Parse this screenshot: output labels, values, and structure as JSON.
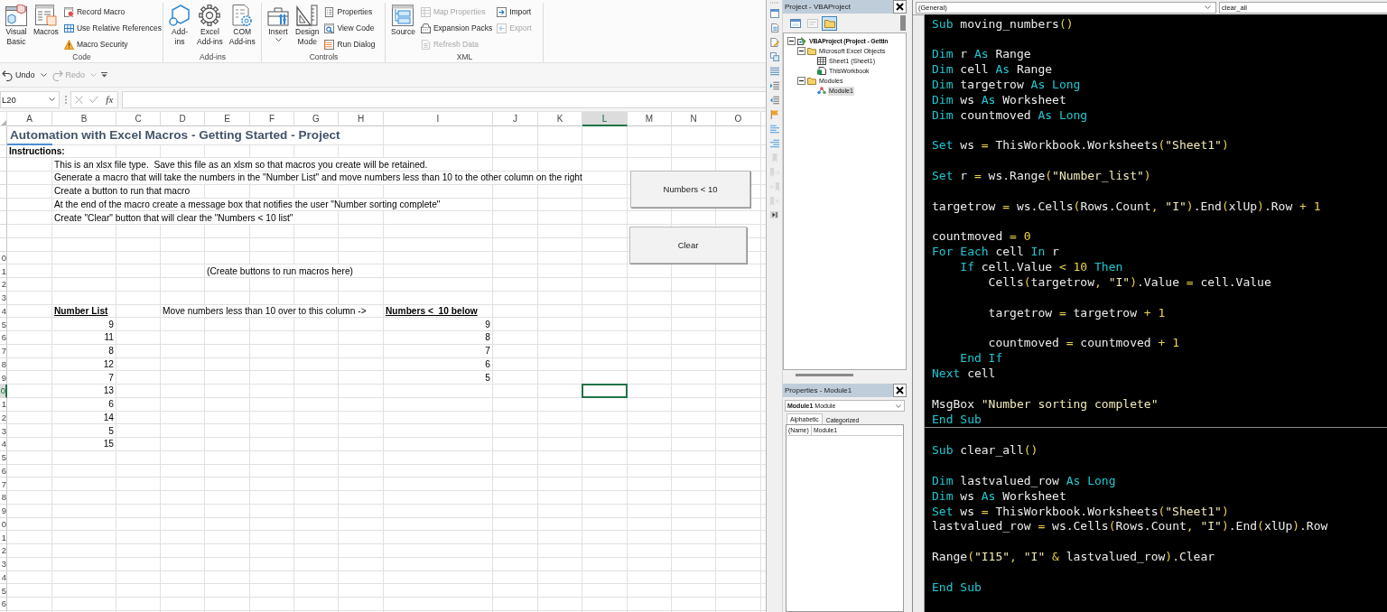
{
  "ribbon": {
    "groups": [
      {
        "label": "Code",
        "items": [
          {
            "label": "Visual\nBasic",
            "kind": "large",
            "disabled": false,
            "menu": false
          },
          {
            "label": "Macros",
            "kind": "large",
            "disabled": false,
            "menu": false
          },
          {
            "label": "Record Macro",
            "kind": "small",
            "disabled": false,
            "menu": false
          },
          {
            "label": "Use Relative References",
            "kind": "small",
            "disabled": false,
            "menu": false
          },
          {
            "label": "Macro Security",
            "kind": "small",
            "disabled": false,
            "menu": false
          }
        ]
      },
      {
        "label": "Add-ins",
        "items": [
          {
            "label": "Add-\nins",
            "kind": "large",
            "disabled": false,
            "menu": false
          },
          {
            "label": "Excel\nAdd-ins",
            "kind": "large",
            "disabled": false,
            "menu": false
          },
          {
            "label": "COM\nAdd-ins",
            "kind": "large",
            "disabled": false,
            "menu": false
          }
        ]
      },
      {
        "label": "Controls",
        "items": [
          {
            "label": "Insert",
            "kind": "large",
            "disabled": false,
            "menu": true
          },
          {
            "label": "Design\nMode",
            "kind": "large",
            "disabled": false,
            "menu": false
          },
          {
            "label": "Properties",
            "kind": "small",
            "disabled": false,
            "menu": false
          },
          {
            "label": "View Code",
            "kind": "small",
            "disabled": false,
            "menu": false
          },
          {
            "label": "Run Dialog",
            "kind": "small",
            "disabled": false,
            "menu": false
          }
        ]
      },
      {
        "label": "XML",
        "items": [
          {
            "label": "Source",
            "kind": "large",
            "disabled": false,
            "menu": false
          },
          {
            "label": "Map Properties",
            "kind": "small",
            "disabled": true,
            "menu": false
          },
          {
            "label": "Expansion Packs",
            "kind": "small",
            "disabled": false,
            "menu": false
          },
          {
            "label": "Refresh Data",
            "kind": "small",
            "disabled": true,
            "menu": false
          },
          {
            "label": "Import",
            "kind": "small",
            "disabled": false,
            "menu": false
          },
          {
            "label": "Export",
            "kind": "small",
            "disabled": true,
            "menu": false
          }
        ]
      }
    ]
  },
  "quick_access": {
    "items": [
      {
        "label": "Undo",
        "disabled": false,
        "menu": true
      },
      {
        "label": "Redo",
        "disabled": true,
        "menu": true
      }
    ]
  },
  "formula_bar": {
    "name_box": "L20",
    "function_label": "fx"
  },
  "sheet": {
    "columns": [
      {
        "label": "A",
        "selected": false
      },
      {
        "label": "B",
        "selected": false
      },
      {
        "label": "C",
        "selected": false
      },
      {
        "label": "D",
        "selected": false
      },
      {
        "label": "E",
        "selected": false
      },
      {
        "label": "F",
        "selected": false
      },
      {
        "label": "G",
        "selected": false
      },
      {
        "label": "H",
        "selected": false
      },
      {
        "label": "I",
        "selected": false
      },
      {
        "label": "J",
        "selected": false
      },
      {
        "label": "K",
        "selected": false
      },
      {
        "label": "L",
        "selected": true
      },
      {
        "label": "M",
        "selected": false
      },
      {
        "label": "N",
        "selected": false
      },
      {
        "label": "O",
        "selected": false
      }
    ],
    "rows": [
      {
        "selected": false,
        "cells": [
          {
            "text": "Automation with Excel Macros - Getting Started - Project",
            "kind": "title"
          }
        ]
      },
      {
        "selected": false,
        "cells": [
          {
            "text": "Instructions:",
            "kind": "bold"
          }
        ]
      },
      {
        "selected": false,
        "cells": [
          null,
          {
            "text": "This is an xlsx file type.  Save this file as an xlsm so that macros you create will be retained.",
            "kind": "text"
          }
        ]
      },
      {
        "selected": false,
        "cells": [
          null,
          {
            "text": "Generate a macro that will take the numbers in the \"Number List\" and move numbers less than 10 to the other column on the right",
            "kind": "text"
          }
        ]
      },
      {
        "selected": false,
        "cells": [
          null,
          {
            "text": "Create a button to run that macro",
            "kind": "text"
          }
        ]
      },
      {
        "selected": false,
        "cells": [
          null,
          {
            "text": "At the end of the macro create a message box that notifies the user \"Number sorting complete\"",
            "kind": "text"
          }
        ]
      },
      {
        "selected": false,
        "cells": [
          null,
          {
            "text": "Create \"Clear\" button that will clear the \"Numbers < 10 list\"",
            "kind": "text"
          }
        ]
      },
      {
        "selected": false
      },
      {
        "selected": false
      },
      {
        "header": "0",
        "selected": false
      },
      {
        "header": "1",
        "selected": false,
        "cells": [
          null,
          null,
          null,
          null,
          {
            "text": "(Create buttons to run macros here)",
            "kind": "text"
          }
        ]
      },
      {
        "header": "2",
        "selected": false
      },
      {
        "header": "3",
        "selected": false
      },
      {
        "header": "4",
        "selected": false,
        "cells": [
          null,
          {
            "text": "Number List",
            "kind": "heading"
          },
          null,
          {
            "text": "Move numbers less than 10 over to this column ->",
            "kind": "text"
          },
          null,
          null,
          null,
          null,
          {
            "text": "Numbers <  10 below",
            "kind": "heading"
          }
        ]
      },
      {
        "header": "5",
        "selected": false,
        "cells": [
          null,
          {
            "text": "9",
            "kind": "number"
          },
          null,
          null,
          null,
          null,
          null,
          null,
          {
            "text": "9",
            "kind": "number"
          }
        ]
      },
      {
        "header": "6",
        "selected": false,
        "cells": [
          null,
          {
            "text": "11",
            "kind": "number"
          },
          null,
          null,
          null,
          null,
          null,
          null,
          {
            "text": "8",
            "kind": "number"
          }
        ]
      },
      {
        "header": "7",
        "selected": false,
        "cells": [
          null,
          {
            "text": "8",
            "kind": "number"
          },
          null,
          null,
          null,
          null,
          null,
          null,
          {
            "text": "7",
            "kind": "number"
          }
        ]
      },
      {
        "header": "8",
        "selected": false,
        "cells": [
          null,
          {
            "text": "12",
            "kind": "number"
          },
          null,
          null,
          null,
          null,
          null,
          null,
          {
            "text": "6",
            "kind": "number"
          }
        ]
      },
      {
        "header": "9",
        "selected": false,
        "cells": [
          null,
          {
            "text": "7",
            "kind": "number"
          },
          null,
          null,
          null,
          null,
          null,
          null,
          {
            "text": "5",
            "kind": "number"
          }
        ]
      },
      {
        "header": "0",
        "selected": true,
        "cells": [
          null,
          {
            "text": "13",
            "kind": "number"
          }
        ]
      },
      {
        "header": "1",
        "selected": false,
        "cells": [
          null,
          {
            "text": "6",
            "kind": "number"
          }
        ]
      },
      {
        "header": "2",
        "selected": false,
        "cells": [
          null,
          {
            "text": "14",
            "kind": "number"
          }
        ]
      },
      {
        "header": "3",
        "selected": false,
        "cells": [
          null,
          {
            "text": "5",
            "kind": "number"
          }
        ]
      },
      {
        "header": "4",
        "selected": false,
        "cells": [
          null,
          {
            "text": "15",
            "kind": "number"
          }
        ]
      },
      {
        "header": "5",
        "selected": false
      },
      {
        "header": "6",
        "selected": false
      },
      {
        "header": "7",
        "selected": false
      },
      {
        "header": "8",
        "selected": false
      },
      {
        "header": "9",
        "selected": false
      },
      {
        "header": "0",
        "selected": false
      },
      {
        "header": "1",
        "selected": false
      },
      {
        "header": "2",
        "selected": false
      },
      {
        "header": "3",
        "selected": false
      },
      {
        "header": "4",
        "selected": false
      },
      {
        "header": "5",
        "selected": false
      },
      {
        "header": "6",
        "selected": false
      }
    ],
    "buttons": [
      {
        "label": "Numbers < 10"
      },
      {
        "label": "Clear"
      }
    ]
  },
  "vbe": {
    "side_toolbar": [
      {
        "disabled": false
      },
      {
        "disabled": false
      },
      {
        "disabled": false
      },
      {
        "disabled": false
      },
      {
        "disabled": false
      },
      {
        "disabled": false
      },
      {
        "disabled": false
      },
      {
        "disabled": false
      },
      {
        "disabled": false
      },
      {
        "disabled": false
      },
      {
        "disabled": true
      },
      {
        "disabled": true
      },
      {
        "disabled": true
      },
      {
        "disabled": true
      }
    ],
    "project": {
      "title": "Project - VBAProject",
      "toolbar": [
        {
          "disabled": false,
          "pressed": false
        },
        {
          "disabled": true,
          "pressed": false
        },
        {
          "disabled": false,
          "pressed": true
        }
      ],
      "tree": [
        {
          "label": "VBAProject (Project - Gettin",
          "kind": "project",
          "expanded": true,
          "selected": false,
          "children": [
            {
              "label": "Microsoft Excel Objects",
              "kind": "folder",
              "expanded": true,
              "selected": false,
              "children": [
                {
                  "label": "Sheet1 (Sheet1)",
                  "kind": "sheet",
                  "selected": false
                },
                {
                  "label": "ThisWorkbook",
                  "kind": "workbook",
                  "selected": false
                }
              ]
            },
            {
              "label": "Modules",
              "kind": "folder",
              "expanded": true,
              "selected": false,
              "children": [
                {
                  "label": "Module1",
                  "kind": "module",
                  "selected": true
                }
              ]
            }
          ]
        }
      ]
    },
    "properties": {
      "title": "Properties - Module1",
      "object": "**Module1** Module",
      "tabs": [
        {
          "label": "Alphabetic",
          "selected": true
        },
        {
          "label": "Categorized",
          "selected": false
        }
      ],
      "rows": [
        {
          "name": "(Name)",
          "value": "Module1"
        }
      ]
    },
    "code": {
      "object_box": "(General)",
      "procedure_box": "clear_all",
      "procedures": [
        {
          "lines": [
            {
              "kind": "code",
              "tokens": [
                {
                  "text": "Sub",
                  "kind": "keyword"
                },
                {
                  "text": " moving_numbers",
                  "kind": "plain"
                },
                {
                  "text": "()",
                  "kind": "operator"
                }
              ]
            },
            {
              "kind": "blank"
            },
            {
              "kind": "code",
              "tokens": [
                {
                  "text": "Dim",
                  "kind": "keyword"
                },
                {
                  "text": " r ",
                  "kind": "plain"
                },
                {
                  "text": "As",
                  "kind": "keyword"
                },
                {
                  "text": " Range",
                  "kind": "plain"
                }
              ]
            },
            {
              "kind": "code",
              "tokens": [
                {
                  "text": "Dim",
                  "kind": "keyword"
                },
                {
                  "text": " cell ",
                  "kind": "plain"
                },
                {
                  "text": "As",
                  "kind": "keyword"
                },
                {
                  "text": " Range",
                  "kind": "plain"
                }
              ]
            },
            {
              "kind": "code",
              "tokens": [
                {
                  "text": "Dim",
                  "kind": "keyword"
                },
                {
                  "text": " targetrow ",
                  "kind": "plain"
                },
                {
                  "text": "As Long",
                  "kind": "keyword"
                }
              ]
            },
            {
              "kind": "code",
              "tokens": [
                {
                  "text": "Dim",
                  "kind": "keyword"
                },
                {
                  "text": " ws ",
                  "kind": "plain"
                },
                {
                  "text": "As",
                  "kind": "keyword"
                },
                {
                  "text": " Worksheet",
                  "kind": "plain"
                }
              ]
            },
            {
              "kind": "code",
              "tokens": [
                {
                  "text": "Dim",
                  "kind": "keyword"
                },
                {
                  "text": " countmoved ",
                  "kind": "plain"
                },
                {
                  "text": "As Long",
                  "kind": "keyword"
                }
              ]
            },
            {
              "kind": "blank"
            },
            {
              "kind": "code",
              "tokens": [
                {
                  "text": "Set",
                  "kind": "keyword"
                },
                {
                  "text": " ws ",
                  "kind": "plain"
                },
                {
                  "text": "=",
                  "kind": "operator"
                },
                {
                  "text": " ThisWorkbook.Worksheets",
                  "kind": "plain"
                },
                {
                  "text": "(",
                  "kind": "operator"
                },
                {
                  "text": "\"Sheet1\"",
                  "kind": "string"
                },
                {
                  "text": ")",
                  "kind": "operator"
                }
              ]
            },
            {
              "kind": "blank"
            },
            {
              "kind": "code",
              "tokens": [
                {
                  "text": "Set",
                  "kind": "keyword"
                },
                {
                  "text": " r ",
                  "kind": "plain"
                },
                {
                  "text": "=",
                  "kind": "operator"
                },
                {
                  "text": " ws.Range",
                  "kind": "plain"
                },
                {
                  "text": "(",
                  "kind": "operator"
                },
                {
                  "text": "\"Number_list\"",
                  "kind": "string"
                },
                {
                  "text": ")",
                  "kind": "operator"
                }
              ]
            },
            {
              "kind": "blank"
            },
            {
              "kind": "code",
              "tokens": [
                {
                  "text": "targetrow ",
                  "kind": "plain"
                },
                {
                  "text": "=",
                  "kind": "operator"
                },
                {
                  "text": " ws.Cells",
                  "kind": "plain"
                },
                {
                  "text": "(",
                  "kind": "operator"
                },
                {
                  "text": "Rows.Count",
                  "kind": "plain"
                },
                {
                  "text": ", ",
                  "kind": "operator"
                },
                {
                  "text": "\"I\"",
                  "kind": "string"
                },
                {
                  "text": ")",
                  "kind": "operator"
                },
                {
                  "text": ".End",
                  "kind": "plain"
                },
                {
                  "text": "(",
                  "kind": "operator"
                },
                {
                  "text": "xlUp",
                  "kind": "plain"
                },
                {
                  "text": ")",
                  "kind": "operator"
                },
                {
                  "text": ".Row ",
                  "kind": "plain"
                },
                {
                  "text": "+ ",
                  "kind": "operator"
                },
                {
                  "text": "1",
                  "kind": "number"
                }
              ]
            },
            {
              "kind": "blank"
            },
            {
              "kind": "code",
              "tokens": [
                {
                  "text": "countmoved ",
                  "kind": "plain"
                },
                {
                  "text": "= ",
                  "kind": "operator"
                },
                {
                  "text": "0",
                  "kind": "number"
                }
              ]
            },
            {
              "kind": "code",
              "tokens": [
                {
                  "text": "For Each",
                  "kind": "keyword"
                },
                {
                  "text": " cell ",
                  "kind": "plain"
                },
                {
                  "text": "In",
                  "kind": "keyword"
                },
                {
                  "text": " r",
                  "kind": "plain"
                }
              ]
            },
            {
              "kind": "code",
              "tokens": [
                {
                  "text": "    If",
                  "kind": "keyword"
                },
                {
                  "text": " cell.Value ",
                  "kind": "plain"
                },
                {
                  "text": "< ",
                  "kind": "operator"
                },
                {
                  "text": "10",
                  "kind": "number"
                },
                {
                  "text": " Then",
                  "kind": "keyword"
                }
              ]
            },
            {
              "kind": "code",
              "tokens": [
                {
                  "text": "        Cells",
                  "kind": "plain"
                },
                {
                  "text": "(",
                  "kind": "operator"
                },
                {
                  "text": "targetrow",
                  "kind": "plain"
                },
                {
                  "text": ", ",
                  "kind": "operator"
                },
                {
                  "text": "\"I\"",
                  "kind": "string"
                },
                {
                  "text": ")",
                  "kind": "operator"
                },
                {
                  "text": ".Value ",
                  "kind": "plain"
                },
                {
                  "text": "=",
                  "kind": "operator"
                },
                {
                  "text": " cell.Value",
                  "kind": "plain"
                }
              ]
            },
            {
              "kind": "blank"
            },
            {
              "kind": "code",
              "tokens": [
                {
                  "text": "        targetrow ",
                  "kind": "plain"
                },
                {
                  "text": "=",
                  "kind": "operator"
                },
                {
                  "text": " targetrow ",
                  "kind": "plain"
                },
                {
                  "text": "+ ",
                  "kind": "operator"
                },
                {
                  "text": "1",
                  "kind": "number"
                }
              ]
            },
            {
              "kind": "blank"
            },
            {
              "kind": "code",
              "tokens": [
                {
                  "text": "        countmoved ",
                  "kind": "plain"
                },
                {
                  "text": "=",
                  "kind": "operator"
                },
                {
                  "text": " countmoved ",
                  "kind": "plain"
                },
                {
                  "text": "+ ",
                  "kind": "operator"
                },
                {
                  "text": "1",
                  "kind": "number"
                }
              ]
            },
            {
              "kind": "code",
              "tokens": [
                {
                  "text": "    End If",
                  "kind": "keyword"
                }
              ]
            },
            {
              "kind": "code",
              "tokens": [
                {
                  "text": "Next",
                  "kind": "keyword"
                },
                {
                  "text": " cell",
                  "kind": "plain"
                }
              ]
            },
            {
              "kind": "blank"
            },
            {
              "kind": "code",
              "tokens": [
                {
                  "text": "MsgBox ",
                  "kind": "plain"
                },
                {
                  "text": "\"Number sorting complete\"",
                  "kind": "string"
                }
              ]
            },
            {
              "kind": "code",
              "tokens": [
                {
                  "text": "End Sub",
                  "kind": "keyword"
                }
              ]
            }
          ]
        },
        {
          "lines": [
            {
              "kind": "blank"
            },
            {
              "kind": "code",
              "tokens": [
                {
                  "text": "Sub",
                  "kind": "keyword"
                },
                {
                  "text": " clear_all",
                  "kind": "plain"
                },
                {
                  "text": "()",
                  "kind": "operator"
                }
              ]
            },
            {
              "kind": "blank"
            },
            {
              "kind": "code",
              "tokens": [
                {
                  "text": "Dim",
                  "kind": "keyword"
                },
                {
                  "text": " lastvalued_row ",
                  "kind": "plain"
                },
                {
                  "text": "As Long",
                  "kind": "keyword"
                }
              ]
            },
            {
              "kind": "code",
              "tokens": [
                {
                  "text": "Dim",
                  "kind": "keyword"
                },
                {
                  "text": " ws ",
                  "kind": "plain"
                },
                {
                  "text": "As",
                  "kind": "keyword"
                },
                {
                  "text": " Worksheet",
                  "kind": "plain"
                }
              ]
            },
            {
              "kind": "code",
              "tokens": [
                {
                  "text": "Set",
                  "kind": "keyword"
                },
                {
                  "text": " ws ",
                  "kind": "plain"
                },
                {
                  "text": "=",
                  "kind": "operator"
                },
                {
                  "text": " ThisWorkbook.Worksheets",
                  "kind": "plain"
                },
                {
                  "text": "(",
                  "kind": "operator"
                },
                {
                  "text": "\"Sheet1\"",
                  "kind": "string"
                },
                {
                  "text": ")",
                  "kind": "operator"
                }
              ]
            },
            {
              "kind": "code",
              "tokens": [
                {
                  "text": "lastvalued_row ",
                  "kind": "plain"
                },
                {
                  "text": "=",
                  "kind": "operator"
                },
                {
                  "text": " ws.Cells",
                  "kind": "plain"
                },
                {
                  "text": "(",
                  "kind": "operator"
                },
                {
                  "text": "Rows.Count",
                  "kind": "plain"
                },
                {
                  "text": ", ",
                  "kind": "operator"
                },
                {
                  "text": "\"I\"",
                  "kind": "string"
                },
                {
                  "text": ")",
                  "kind": "operator"
                },
                {
                  "text": ".End",
                  "kind": "plain"
                },
                {
                  "text": "(",
                  "kind": "operator"
                },
                {
                  "text": "xlUp",
                  "kind": "plain"
                },
                {
                  "text": ")",
                  "kind": "operator"
                },
                {
                  "text": ".Row",
                  "kind": "plain"
                }
              ]
            },
            {
              "kind": "blank"
            },
            {
              "kind": "code",
              "tokens": [
                {
                  "text": "Range",
                  "kind": "plain"
                },
                {
                  "text": "(",
                  "kind": "operator"
                },
                {
                  "text": "\"I15\"",
                  "kind": "string"
                },
                {
                  "text": ", ",
                  "kind": "operator"
                },
                {
                  "text": "\"I\"",
                  "kind": "string"
                },
                {
                  "text": " &",
                  "kind": "operator"
                },
                {
                  "text": " lastvalued_row",
                  "kind": "plain"
                },
                {
                  "text": ")",
                  "kind": "operator"
                },
                {
                  "text": ".Clear",
                  "kind": "plain"
                }
              ]
            },
            {
              "kind": "blank"
            },
            {
              "kind": "code",
              "tokens": [
                {
                  "text": "End Sub",
                  "kind": "keyword"
                }
              ]
            }
          ]
        }
      ]
    }
  }
}
